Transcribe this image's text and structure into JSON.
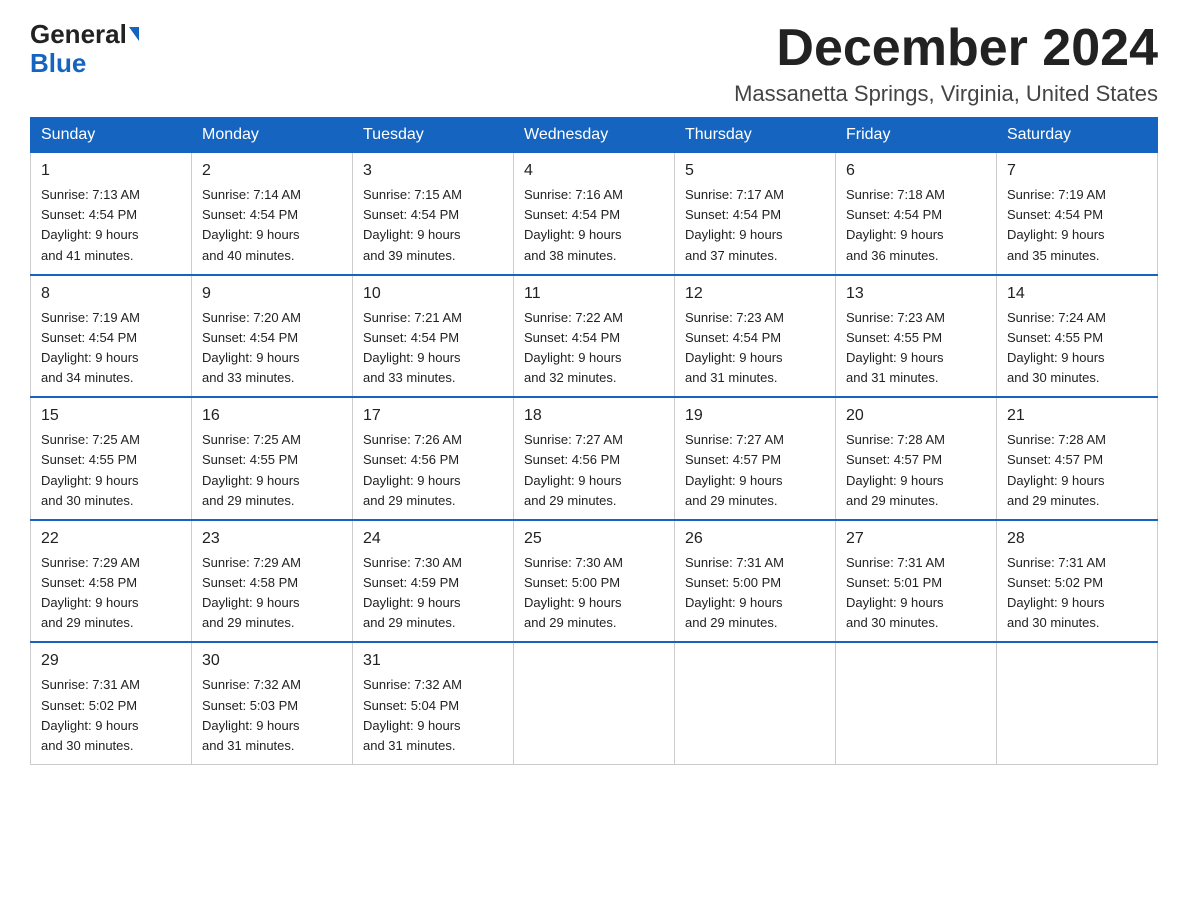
{
  "header": {
    "logo_general": "General",
    "logo_blue": "Blue",
    "month_title": "December 2024",
    "location": "Massanetta Springs, Virginia, United States"
  },
  "weekdays": [
    "Sunday",
    "Monday",
    "Tuesday",
    "Wednesday",
    "Thursday",
    "Friday",
    "Saturday"
  ],
  "weeks": [
    [
      {
        "day": "1",
        "sunrise": "7:13 AM",
        "sunset": "4:54 PM",
        "daylight": "9 hours and 41 minutes."
      },
      {
        "day": "2",
        "sunrise": "7:14 AM",
        "sunset": "4:54 PM",
        "daylight": "9 hours and 40 minutes."
      },
      {
        "day": "3",
        "sunrise": "7:15 AM",
        "sunset": "4:54 PM",
        "daylight": "9 hours and 39 minutes."
      },
      {
        "day": "4",
        "sunrise": "7:16 AM",
        "sunset": "4:54 PM",
        "daylight": "9 hours and 38 minutes."
      },
      {
        "day": "5",
        "sunrise": "7:17 AM",
        "sunset": "4:54 PM",
        "daylight": "9 hours and 37 minutes."
      },
      {
        "day": "6",
        "sunrise": "7:18 AM",
        "sunset": "4:54 PM",
        "daylight": "9 hours and 36 minutes."
      },
      {
        "day": "7",
        "sunrise": "7:19 AM",
        "sunset": "4:54 PM",
        "daylight": "9 hours and 35 minutes."
      }
    ],
    [
      {
        "day": "8",
        "sunrise": "7:19 AM",
        "sunset": "4:54 PM",
        "daylight": "9 hours and 34 minutes."
      },
      {
        "day": "9",
        "sunrise": "7:20 AM",
        "sunset": "4:54 PM",
        "daylight": "9 hours and 33 minutes."
      },
      {
        "day": "10",
        "sunrise": "7:21 AM",
        "sunset": "4:54 PM",
        "daylight": "9 hours and 33 minutes."
      },
      {
        "day": "11",
        "sunrise": "7:22 AM",
        "sunset": "4:54 PM",
        "daylight": "9 hours and 32 minutes."
      },
      {
        "day": "12",
        "sunrise": "7:23 AM",
        "sunset": "4:54 PM",
        "daylight": "9 hours and 31 minutes."
      },
      {
        "day": "13",
        "sunrise": "7:23 AM",
        "sunset": "4:55 PM",
        "daylight": "9 hours and 31 minutes."
      },
      {
        "day": "14",
        "sunrise": "7:24 AM",
        "sunset": "4:55 PM",
        "daylight": "9 hours and 30 minutes."
      }
    ],
    [
      {
        "day": "15",
        "sunrise": "7:25 AM",
        "sunset": "4:55 PM",
        "daylight": "9 hours and 30 minutes."
      },
      {
        "day": "16",
        "sunrise": "7:25 AM",
        "sunset": "4:55 PM",
        "daylight": "9 hours and 29 minutes."
      },
      {
        "day": "17",
        "sunrise": "7:26 AM",
        "sunset": "4:56 PM",
        "daylight": "9 hours and 29 minutes."
      },
      {
        "day": "18",
        "sunrise": "7:27 AM",
        "sunset": "4:56 PM",
        "daylight": "9 hours and 29 minutes."
      },
      {
        "day": "19",
        "sunrise": "7:27 AM",
        "sunset": "4:57 PM",
        "daylight": "9 hours and 29 minutes."
      },
      {
        "day": "20",
        "sunrise": "7:28 AM",
        "sunset": "4:57 PM",
        "daylight": "9 hours and 29 minutes."
      },
      {
        "day": "21",
        "sunrise": "7:28 AM",
        "sunset": "4:57 PM",
        "daylight": "9 hours and 29 minutes."
      }
    ],
    [
      {
        "day": "22",
        "sunrise": "7:29 AM",
        "sunset": "4:58 PM",
        "daylight": "9 hours and 29 minutes."
      },
      {
        "day": "23",
        "sunrise": "7:29 AM",
        "sunset": "4:58 PM",
        "daylight": "9 hours and 29 minutes."
      },
      {
        "day": "24",
        "sunrise": "7:30 AM",
        "sunset": "4:59 PM",
        "daylight": "9 hours and 29 minutes."
      },
      {
        "day": "25",
        "sunrise": "7:30 AM",
        "sunset": "5:00 PM",
        "daylight": "9 hours and 29 minutes."
      },
      {
        "day": "26",
        "sunrise": "7:31 AM",
        "sunset": "5:00 PM",
        "daylight": "9 hours and 29 minutes."
      },
      {
        "day": "27",
        "sunrise": "7:31 AM",
        "sunset": "5:01 PM",
        "daylight": "9 hours and 30 minutes."
      },
      {
        "day": "28",
        "sunrise": "7:31 AM",
        "sunset": "5:02 PM",
        "daylight": "9 hours and 30 minutes."
      }
    ],
    [
      {
        "day": "29",
        "sunrise": "7:31 AM",
        "sunset": "5:02 PM",
        "daylight": "9 hours and 30 minutes."
      },
      {
        "day": "30",
        "sunrise": "7:32 AM",
        "sunset": "5:03 PM",
        "daylight": "9 hours and 31 minutes."
      },
      {
        "day": "31",
        "sunrise": "7:32 AM",
        "sunset": "5:04 PM",
        "daylight": "9 hours and 31 minutes."
      },
      null,
      null,
      null,
      null
    ]
  ],
  "labels": {
    "sunrise": "Sunrise:",
    "sunset": "Sunset:",
    "daylight": "Daylight:"
  }
}
